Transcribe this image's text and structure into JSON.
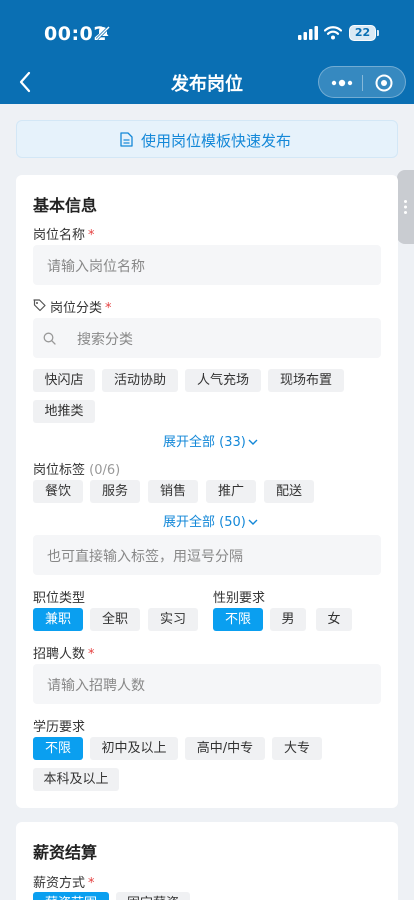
{
  "status": {
    "time": "00:02",
    "battery": "22"
  },
  "nav": {
    "title": "发布岗位"
  },
  "template_button": {
    "label": "使用岗位模板快速发布"
  },
  "basic": {
    "title": "基本信息",
    "name": {
      "label": "岗位名称",
      "required": "*",
      "placeholder": "请输入岗位名称"
    },
    "category": {
      "label": "岗位分类",
      "required": "*",
      "search_placeholder": "搜索分类",
      "options": [
        "快闪店",
        "活动协助",
        "人气充场",
        "现场布置",
        "地推类"
      ],
      "expand": "展开全部 (33)"
    },
    "tags": {
      "label": "岗位标签",
      "count": "(0/6)",
      "options": [
        "餐饮",
        "服务",
        "销售",
        "推广",
        "配送"
      ],
      "expand": "展开全部 (50)",
      "placeholder": "也可直接输入标签，用逗号分隔"
    },
    "job_type": {
      "label": "职位类型",
      "options": [
        "兼职",
        "全职",
        "实习"
      ],
      "selected": "兼职"
    },
    "gender": {
      "label": "性别要求",
      "options": [
        "不限",
        "男",
        "女"
      ],
      "selected": "不限"
    },
    "headcount": {
      "label": "招聘人数",
      "required": "*",
      "placeholder": "请输入招聘人数"
    },
    "education": {
      "label": "学历要求",
      "options": [
        "不限",
        "初中及以上",
        "高中/中专",
        "大专",
        "本科及以上"
      ],
      "selected": "不限"
    }
  },
  "salary": {
    "title": "薪资结算",
    "method": {
      "label": "薪资方式",
      "required": "*",
      "options": [
        "薪资范围",
        "固定薪资"
      ],
      "selected": "薪资范围"
    }
  },
  "colors": {
    "nav_bg": "#0a6fb3",
    "accent": "#0a9ff0",
    "link": "#1488d8",
    "required": "#e54040"
  }
}
